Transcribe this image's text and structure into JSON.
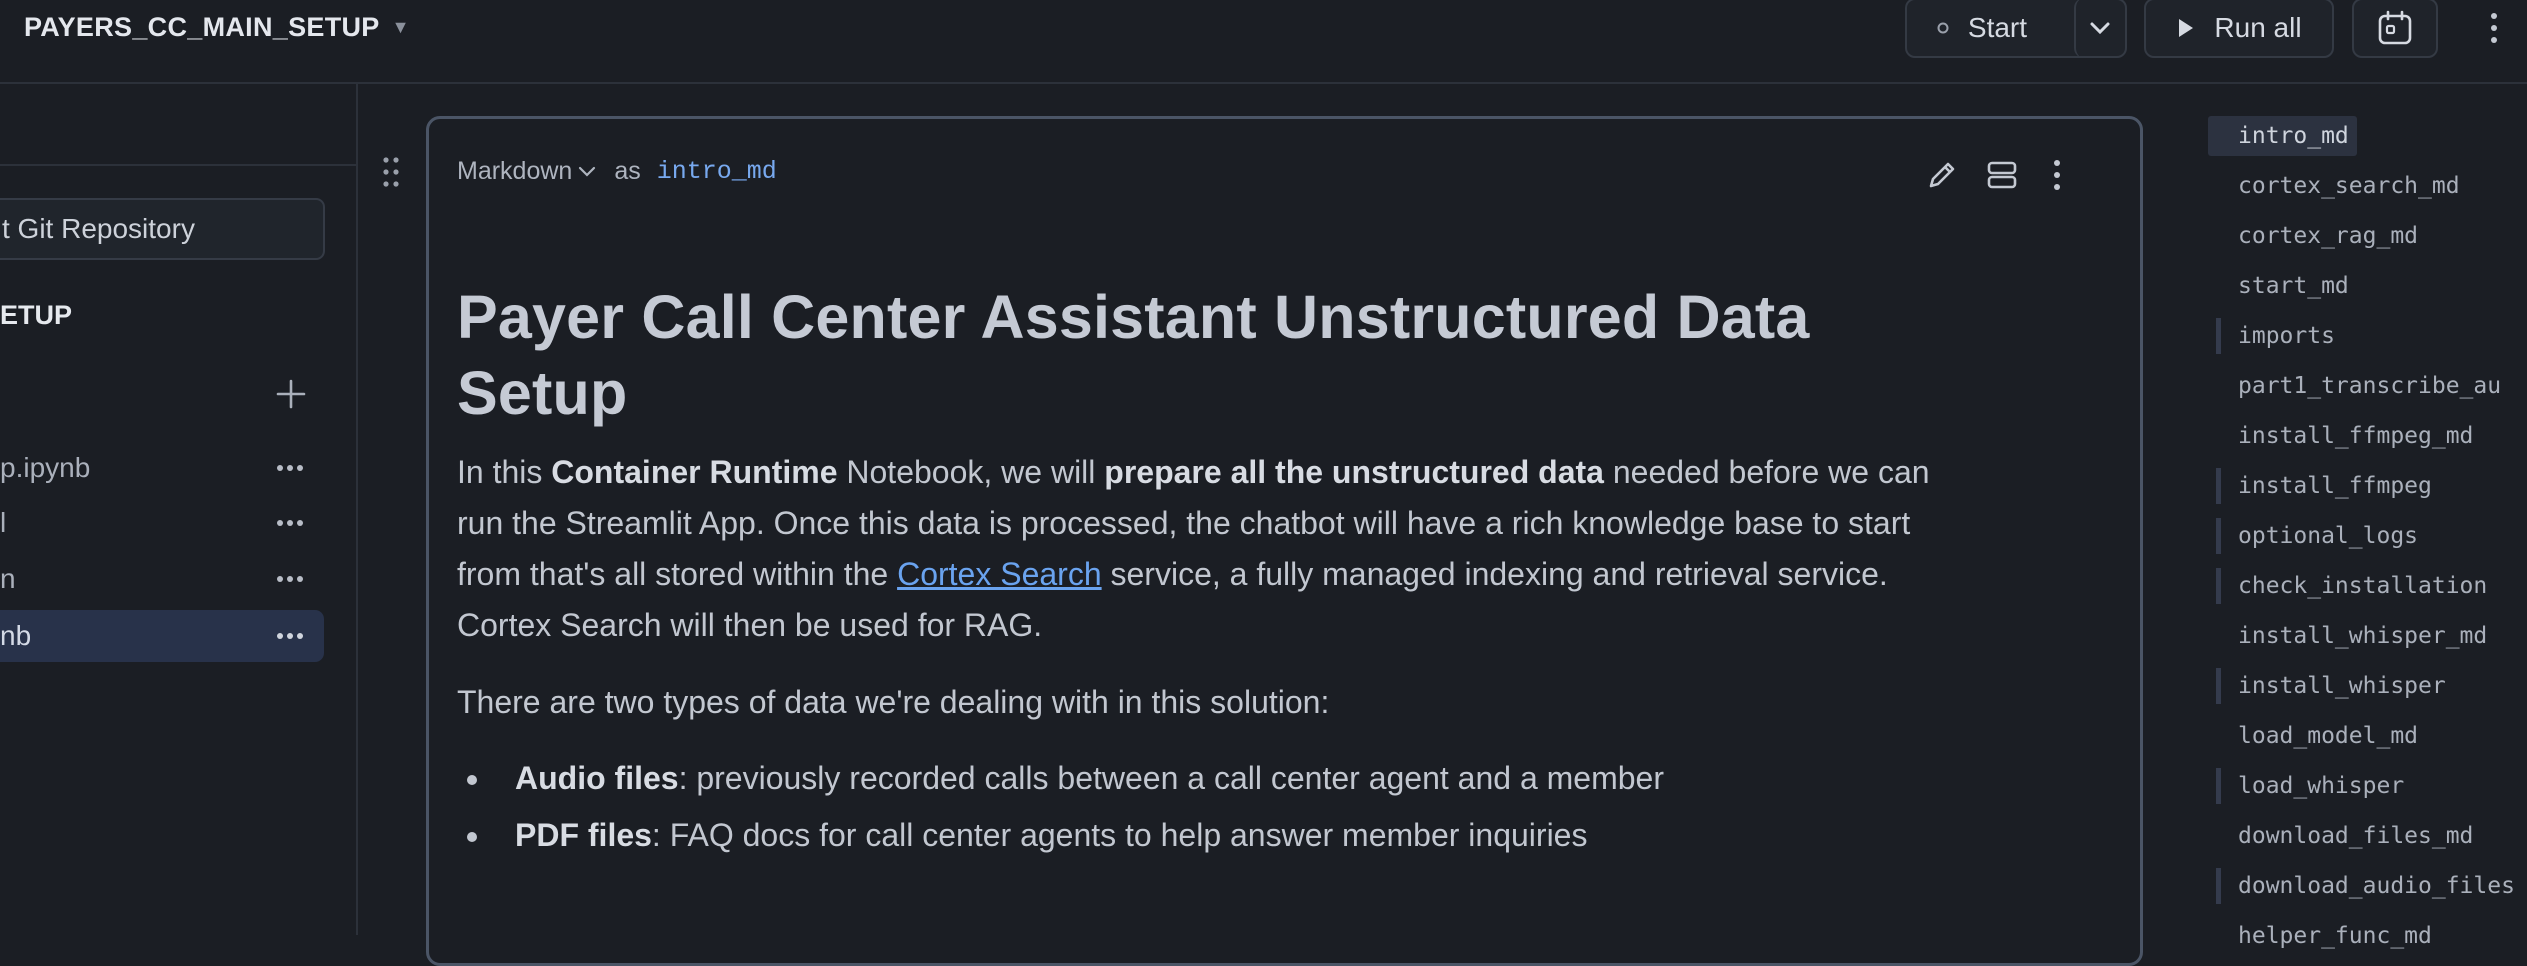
{
  "header": {
    "notebook_title": "PAYERS_CC_MAIN_SETUP",
    "start_label": "Start",
    "run_all_label": "Run all"
  },
  "sidebar": {
    "git_button_label": "t Git Repository",
    "section_title": "ETUP",
    "files": [
      {
        "label": "p.ipynb"
      },
      {
        "label": "l"
      },
      {
        "label": "n"
      },
      {
        "label": "nb"
      }
    ]
  },
  "cell": {
    "type_label": "Markdown",
    "as_label": "as",
    "name": "intro_md",
    "title": "Payer Call Center Assistant Unstructured Data Setup",
    "p1": {
      "t1": "In this ",
      "b1": "Container Runtime",
      "t2": " Notebook, we will ",
      "b2": "prepare all the unstructured data",
      "t3": " needed before we can run the Streamlit App. Once this data is processed, the chatbot will have a rich knowledge base to start from that's all stored within the ",
      "link": "Cortex Search",
      "t4": " service, a fully managed indexing and retrieval service. Cortex Search will then be used for RAG."
    },
    "p2": "There are two types of data we're dealing with in this solution:",
    "list": [
      {
        "bold": "Audio files",
        "text": ": previously recorded calls between a call center agent and a member"
      },
      {
        "bold": "PDF files",
        "text": ": FAQ docs for call center agents to help answer member inquiries"
      }
    ]
  },
  "outline": {
    "items": [
      {
        "label": "intro_md"
      },
      {
        "label": "cortex_search_md"
      },
      {
        "label": "cortex_rag_md"
      },
      {
        "label": "start_md"
      },
      {
        "label": "imports"
      },
      {
        "label": "part1_transcribe_au"
      },
      {
        "label": "install_ffmpeg_md"
      },
      {
        "label": "install_ffmpeg"
      },
      {
        "label": "optional_logs"
      },
      {
        "label": "check_installation"
      },
      {
        "label": "install_whisper_md"
      },
      {
        "label": "install_whisper"
      },
      {
        "label": "load_model_md"
      },
      {
        "label": "load_whisper"
      },
      {
        "label": "download_files_md"
      },
      {
        "label": "download_audio_files"
      },
      {
        "label": "helper_func_md"
      }
    ]
  }
}
